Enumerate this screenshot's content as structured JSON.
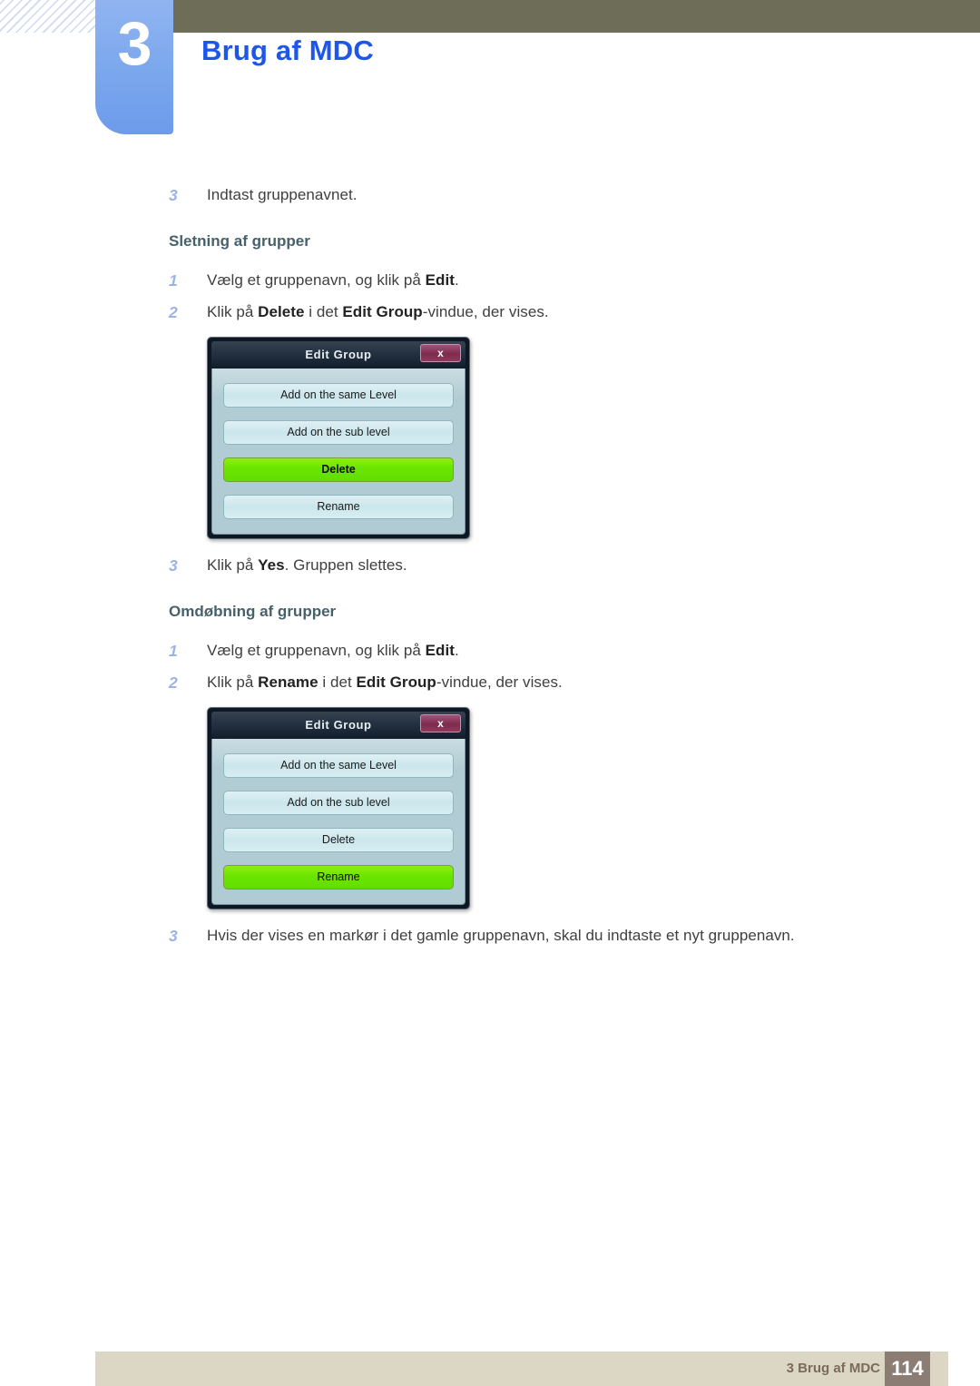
{
  "header": {
    "chapter_number": "3",
    "chapter_title": "Brug af MDC"
  },
  "content": {
    "intro_step": {
      "num": "3",
      "text": "Indtast gruppenavnet."
    },
    "sections": [
      {
        "heading": "Sletning af grupper",
        "steps": [
          {
            "num": "1",
            "parts": [
              {
                "t": "Vælg et gruppenavn, og klik på ",
                "b": false
              },
              {
                "t": "Edit",
                "b": true
              },
              {
                "t": ".",
                "b": false
              }
            ]
          },
          {
            "num": "2",
            "parts": [
              {
                "t": "Klik på ",
                "b": false
              },
              {
                "t": "Delete",
                "b": true
              },
              {
                "t": " i det ",
                "b": false
              },
              {
                "t": "Edit Group",
                "b": true
              },
              {
                "t": "-vindue, der vises.",
                "b": false
              }
            ]
          }
        ],
        "dialog": {
          "title": "Edit Group",
          "close_label": "x",
          "buttons": [
            {
              "label": "Add on the same Level",
              "selected": false,
              "bold": false
            },
            {
              "label": "Add on the sub level",
              "selected": false,
              "bold": false
            },
            {
              "label": "Delete",
              "selected": true,
              "bold": true
            },
            {
              "label": "Rename",
              "selected": false,
              "bold": false
            }
          ]
        },
        "after_steps": [
          {
            "num": "3",
            "parts": [
              {
                "t": "Klik på ",
                "b": false
              },
              {
                "t": "Yes",
                "b": true
              },
              {
                "t": ". Gruppen slettes.",
                "b": false
              }
            ]
          }
        ]
      },
      {
        "heading": "Omdøbning af grupper",
        "steps": [
          {
            "num": "1",
            "parts": [
              {
                "t": "Vælg et gruppenavn, og klik på ",
                "b": false
              },
              {
                "t": "Edit",
                "b": true
              },
              {
                "t": ".",
                "b": false
              }
            ]
          },
          {
            "num": "2",
            "parts": [
              {
                "t": "Klik på ",
                "b": false
              },
              {
                "t": "Rename",
                "b": true
              },
              {
                "t": " i det ",
                "b": false
              },
              {
                "t": "Edit Group",
                "b": true
              },
              {
                "t": "-vindue, der vises.",
                "b": false
              }
            ]
          }
        ],
        "dialog": {
          "title": "Edit Group",
          "close_label": "x",
          "buttons": [
            {
              "label": "Add on the same Level",
              "selected": false,
              "bold": false
            },
            {
              "label": "Add on the sub level",
              "selected": false,
              "bold": false
            },
            {
              "label": "Delete",
              "selected": false,
              "bold": false
            },
            {
              "label": "Rename",
              "selected": true,
              "bold": false
            }
          ]
        },
        "after_steps": [
          {
            "num": "3",
            "parts": [
              {
                "t": "Hvis der vises en markør i det gamle gruppenavn, skal du indtaste et nyt gruppenavn.",
                "b": false
              }
            ]
          }
        ]
      }
    ]
  },
  "footer": {
    "label": "3 Brug af MDC",
    "page_number": "114"
  },
  "colors": {
    "olive_bar": "#6d6d58",
    "chapter_tab": "#7ea9ee",
    "chapter_title": "#1d56e8",
    "step_number": "#9bb4e8",
    "section_heading": "#47616b",
    "dialog_selected_green": "#6ae500",
    "dialog_close_red": "#8e3a5c",
    "footer_bar": "#dcd7c4",
    "footer_page_box": "#8b7d73"
  }
}
